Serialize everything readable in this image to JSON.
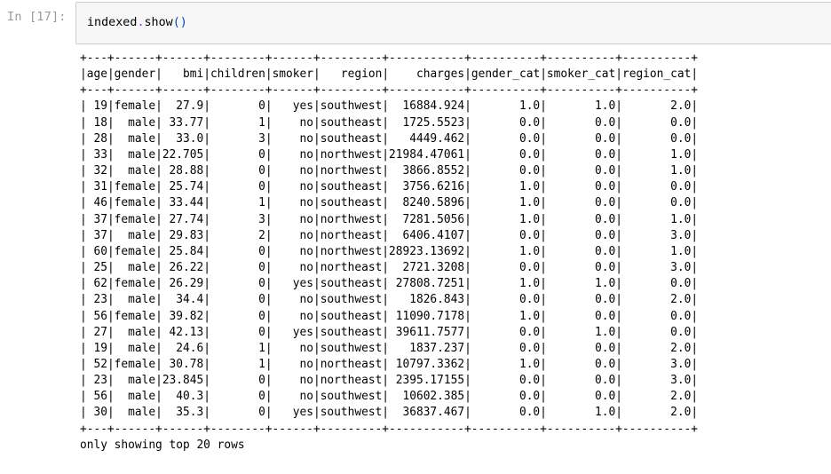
{
  "cell": {
    "prompt": "In [17]:",
    "code": {
      "object": "indexed",
      "dot": ".",
      "method": "show",
      "parens": "()"
    }
  },
  "table": {
    "border": "+---+------+------+--------+------+---------+-----------+----------+----------+----------+",
    "columns": [
      "age",
      "gender",
      "bmi",
      "children",
      "smoker",
      "region",
      "charges",
      "gender_cat",
      "smoker_cat",
      "region_cat"
    ],
    "widths": [
      3,
      6,
      6,
      8,
      6,
      9,
      11,
      10,
      10,
      10
    ],
    "rows": [
      [
        "19",
        "female",
        "27.9",
        "0",
        "yes",
        "southwest",
        "16884.924",
        "1.0",
        "1.0",
        "2.0"
      ],
      [
        "18",
        "male",
        "33.77",
        "1",
        "no",
        "southeast",
        "1725.5523",
        "0.0",
        "0.0",
        "0.0"
      ],
      [
        "28",
        "male",
        "33.0",
        "3",
        "no",
        "southeast",
        "4449.462",
        "0.0",
        "0.0",
        "0.0"
      ],
      [
        "33",
        "male",
        "22.705",
        "0",
        "no",
        "northwest",
        "21984.47061",
        "0.0",
        "0.0",
        "1.0"
      ],
      [
        "32",
        "male",
        "28.88",
        "0",
        "no",
        "northwest",
        "3866.8552",
        "0.0",
        "0.0",
        "1.0"
      ],
      [
        "31",
        "female",
        "25.74",
        "0",
        "no",
        "southeast",
        "3756.6216",
        "1.0",
        "0.0",
        "0.0"
      ],
      [
        "46",
        "female",
        "33.44",
        "1",
        "no",
        "southeast",
        "8240.5896",
        "1.0",
        "0.0",
        "0.0"
      ],
      [
        "37",
        "female",
        "27.74",
        "3",
        "no",
        "northwest",
        "7281.5056",
        "1.0",
        "0.0",
        "1.0"
      ],
      [
        "37",
        "male",
        "29.83",
        "2",
        "no",
        "northeast",
        "6406.4107",
        "0.0",
        "0.0",
        "3.0"
      ],
      [
        "60",
        "female",
        "25.84",
        "0",
        "no",
        "northwest",
        "28923.13692",
        "1.0",
        "0.0",
        "1.0"
      ],
      [
        "25",
        "male",
        "26.22",
        "0",
        "no",
        "northeast",
        "2721.3208",
        "0.0",
        "0.0",
        "3.0"
      ],
      [
        "62",
        "female",
        "26.29",
        "0",
        "yes",
        "southeast",
        "27808.7251",
        "1.0",
        "1.0",
        "0.0"
      ],
      [
        "23",
        "male",
        "34.4",
        "0",
        "no",
        "southwest",
        "1826.843",
        "0.0",
        "0.0",
        "2.0"
      ],
      [
        "56",
        "female",
        "39.82",
        "0",
        "no",
        "southeast",
        "11090.7178",
        "1.0",
        "0.0",
        "0.0"
      ],
      [
        "27",
        "male",
        "42.13",
        "0",
        "yes",
        "southeast",
        "39611.7577",
        "0.0",
        "1.0",
        "0.0"
      ],
      [
        "19",
        "male",
        "24.6",
        "1",
        "no",
        "southwest",
        "1837.237",
        "0.0",
        "0.0",
        "2.0"
      ],
      [
        "52",
        "female",
        "30.78",
        "1",
        "no",
        "northeast",
        "10797.3362",
        "1.0",
        "0.0",
        "3.0"
      ],
      [
        "23",
        "male",
        "23.845",
        "0",
        "no",
        "northeast",
        "2395.17155",
        "0.0",
        "0.0",
        "3.0"
      ],
      [
        "56",
        "male",
        "40.3",
        "0",
        "no",
        "southwest",
        "10602.385",
        "0.0",
        "0.0",
        "2.0"
      ],
      [
        "30",
        "male",
        "35.3",
        "0",
        "yes",
        "southwest",
        "36837.467",
        "0.0",
        "1.0",
        "2.0"
      ]
    ],
    "footer": "only showing top 20 rows"
  }
}
